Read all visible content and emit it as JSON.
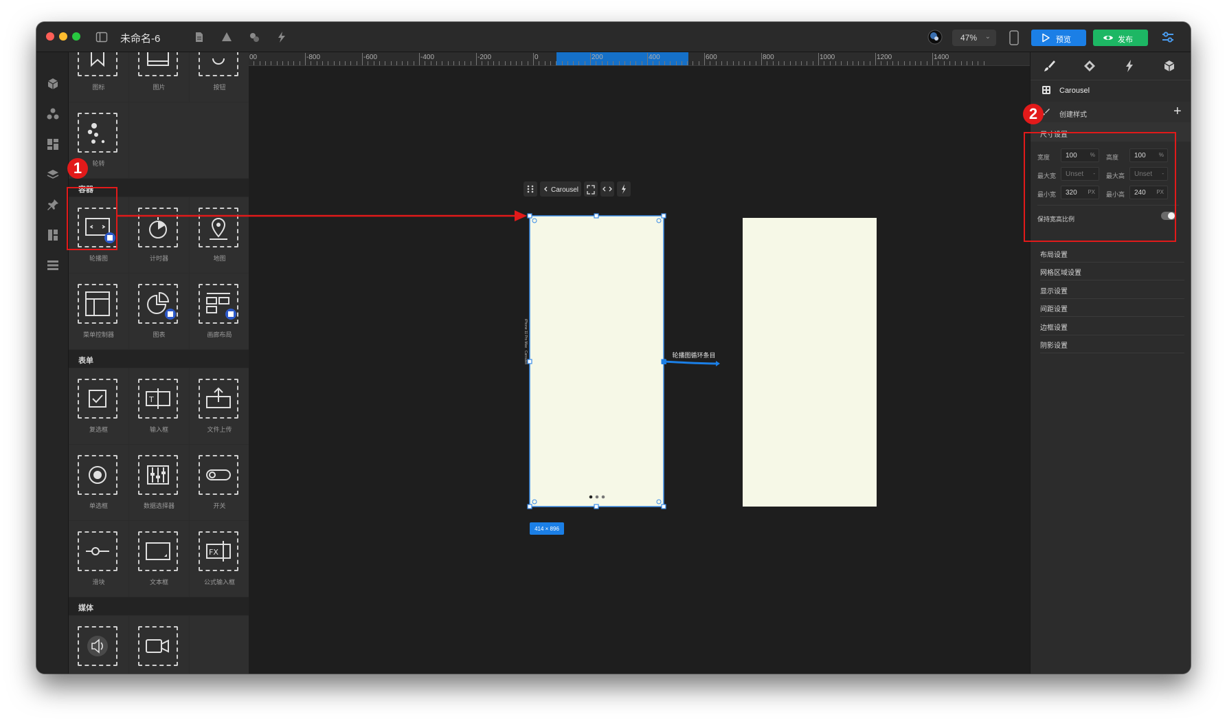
{
  "window": {
    "title": "未命名-6"
  },
  "toolbar": {
    "zoom": "47%",
    "preview_label": "预览",
    "publish_label": "发布"
  },
  "components": {
    "row0": [
      "图标",
      "图片",
      "按钮"
    ],
    "row1": [
      "轮转"
    ],
    "section_container": "容器",
    "row2": [
      "轮播图",
      "计时器",
      "地图"
    ],
    "row3": [
      "菜单控制器",
      "图表",
      "画廊布局"
    ],
    "section_form": "表单",
    "row4": [
      "复选框",
      "输入框",
      "文件上传"
    ],
    "row5": [
      "单选框",
      "数据选择器",
      "开关"
    ],
    "row6": [
      "滑块",
      "文本框",
      "公式输入框"
    ],
    "section_media": "媒体",
    "row7": [
      "音频",
      "视频"
    ]
  },
  "ruler": {
    "ticks": [
      "00",
      "-800",
      "-600",
      "-400",
      "-200",
      "0",
      "200",
      "400",
      "600",
      "800",
      "1000",
      "1200",
      "1400"
    ]
  },
  "canvas": {
    "element_toolbar_label": "Carousel",
    "size_label": "414 × 896",
    "connector_label": "轮播图循环条目",
    "side_label_1": "iPhone 11 Pro Max",
    "side_label_2": "Carousel"
  },
  "inspector": {
    "component_name": "Carousel",
    "create_style": "创建样式",
    "size_section": "尺寸设置",
    "width_label": "宽度",
    "width_value": "100",
    "width_unit": "%",
    "height_label": "高度",
    "height_value": "100",
    "height_unit": "%",
    "maxw_label": "最大宽",
    "maxw_value": "Unset",
    "maxw_unit": "-",
    "maxh_label": "最大高",
    "maxh_value": "Unset",
    "maxh_unit": "-",
    "minw_label": "最小宽",
    "minw_value": "320",
    "minw_unit": "PX",
    "minh_label": "最小高",
    "minh_value": "240",
    "minh_unit": "PX",
    "keep_ratio_label": "保持宽高比例",
    "sections": [
      "布局设置",
      "网格区域设置",
      "显示设置",
      "间距设置",
      "边框设置",
      "阴影设置"
    ]
  },
  "annotations": {
    "badge1": "1",
    "badge2": "2"
  },
  "colors": {
    "accent": "#1b7fe6",
    "publish": "#1db764",
    "annotation": "#e21a1a",
    "frame": "#f6f8e7"
  }
}
